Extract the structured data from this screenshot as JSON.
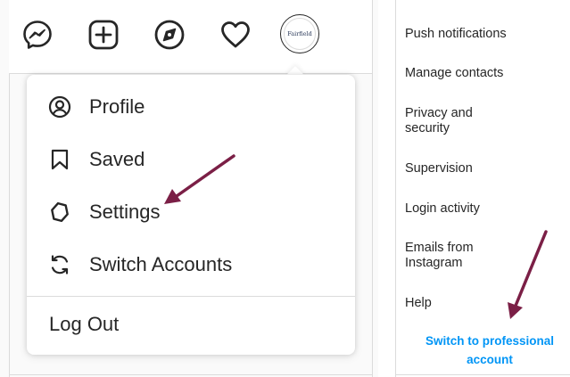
{
  "topbar": {
    "icons": [
      {
        "name": "messenger-icon"
      },
      {
        "name": "new-post-icon"
      },
      {
        "name": "explore-compass-icon"
      },
      {
        "name": "activity-heart-icon"
      }
    ],
    "avatar_text": "Fairfield"
  },
  "dropdown": {
    "items": [
      {
        "label": "Profile",
        "icon": "profile-icon"
      },
      {
        "label": "Saved",
        "icon": "bookmark-icon"
      },
      {
        "label": "Settings",
        "icon": "settings-gear-icon"
      },
      {
        "label": "Switch Accounts",
        "icon": "switch-accounts-icon"
      }
    ],
    "logout_label": "Log Out"
  },
  "settings_menu": {
    "items": [
      {
        "label": "Push notifications"
      },
      {
        "label": "Manage contacts"
      },
      {
        "label": "Privacy and security"
      },
      {
        "label": "Supervision"
      },
      {
        "label": "Login activity"
      },
      {
        "label": "Emails from Instagram"
      },
      {
        "label": "Help"
      }
    ],
    "professional_link": "Switch to professional account"
  },
  "colors": {
    "text": "#262626",
    "link": "#0095f6",
    "arrow": "#7b1f46",
    "border": "#dbdbdb"
  }
}
